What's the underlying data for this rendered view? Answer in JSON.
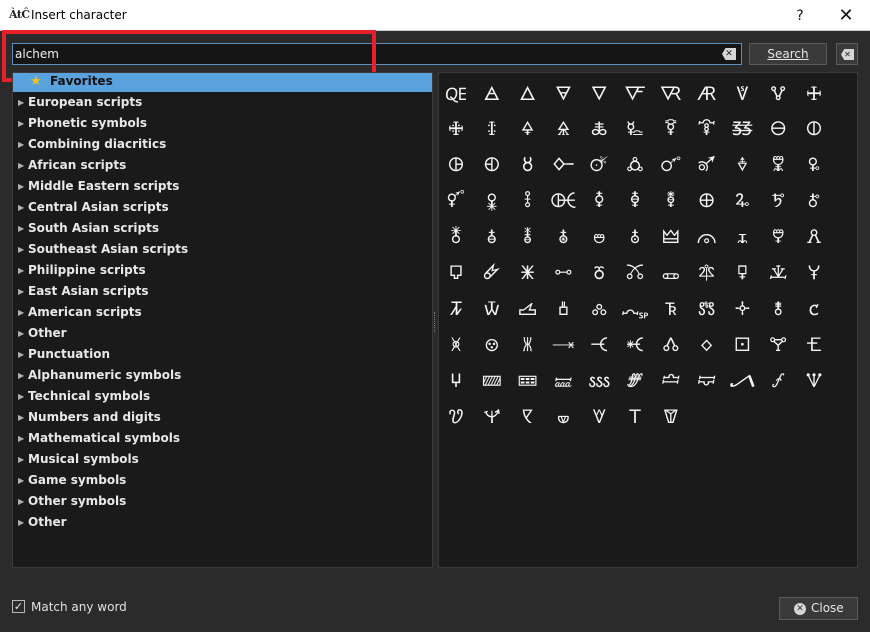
{
  "window": {
    "app_icon": "ÀtĈ",
    "title": "Insert character",
    "help_label": "?",
    "close_label": "✕"
  },
  "search": {
    "value": "alchem",
    "button_label": "Search",
    "clear_icon": "✕",
    "close_icon": "✕"
  },
  "categories": [
    "Favorites",
    "European scripts",
    "Phonetic symbols",
    "Combining diacritics",
    "African scripts",
    "Middle Eastern scripts",
    "Central Asian scripts",
    "South Asian scripts",
    "Southeast Asian scripts",
    "Philippine scripts",
    "East Asian scripts",
    "American scripts",
    "Other",
    "Punctuation",
    "Alphanumeric symbols",
    "Technical symbols",
    "Numbers and digits",
    "Mathematical symbols",
    "Musical symbols",
    "Game symbols",
    "Other symbols",
    "Other"
  ],
  "selected_category": "Favorites",
  "characters": [
    "🜀",
    "🜁",
    "🜂",
    "🜃",
    "🜄",
    "🜅",
    "🜆",
    "🜇",
    "🜈",
    "🜉",
    "🜊",
    "🜋",
    "🜌",
    "🜍",
    "🜎",
    "🜏",
    "🜐",
    "🜑",
    "🜒",
    "🜓",
    "🜔",
    "🜕",
    "🜖",
    "🜗",
    "🜘",
    "🜙",
    "🜚",
    "🜛",
    "🜜",
    "🜝",
    "🜞",
    "🜟",
    "🜠",
    "🜡",
    "🜢",
    "🜣",
    "🜤",
    "🜥",
    "🜦",
    "🜧",
    "🜨",
    "🜩",
    "🜪",
    "🜫",
    "🜬",
    "🜭",
    "🜮",
    "🜯",
    "🜰",
    "🜱",
    "🜲",
    "🜳",
    "🜴",
    "🜵",
    "🜶",
    "🜷",
    "🜸",
    "🜹",
    "🜺",
    "🜻",
    "🜼",
    "🜽",
    "🜾",
    "🜿",
    "🝀",
    "🝁",
    "🝂",
    "🝃",
    "🝄",
    "🝅",
    "🝆",
    "🝇",
    "🝈",
    "🝉",
    "🝊",
    "🝋",
    "🝌",
    "🝍",
    "🝎",
    "🝏",
    "🝐",
    "🝑",
    "🝒",
    "🝓",
    "🝔",
    "🝕",
    "🝖",
    "🝗",
    "🝘",
    "🝙",
    "🝚",
    "🝛",
    "🝜",
    "🝝",
    "🝞",
    "🝟",
    "🝠",
    "🝡",
    "🝢",
    "🝣",
    "🝤",
    "🝥",
    "🝦",
    "🝧",
    "🝨",
    "🝩"
  ],
  "match_any_word": {
    "label": "Match any word",
    "checked": true,
    "check_glyph": "✓"
  },
  "close_button": {
    "label": "Close",
    "icon": "✕"
  }
}
